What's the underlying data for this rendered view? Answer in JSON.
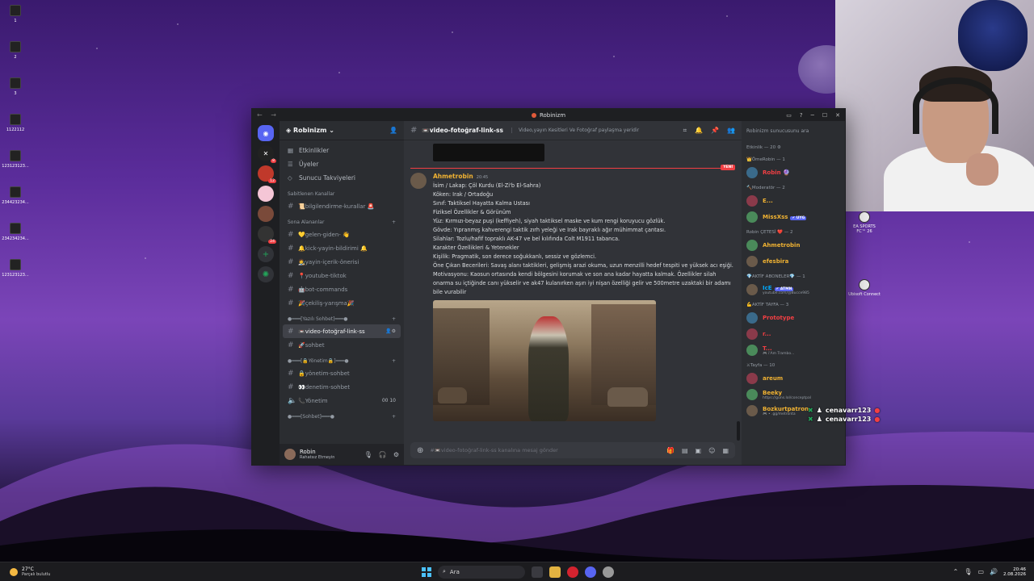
{
  "desktop": {
    "icons": [
      "1",
      "2",
      "3",
      "1122112",
      "123123123...",
      "234423234...",
      "234234234...",
      "123123123..."
    ],
    "right_icons": [
      {
        "label": "EA SPORTS FC™ 26"
      },
      {
        "label": "Ubisoft Connect"
      }
    ]
  },
  "window": {
    "title": "Robinizm",
    "nav": "← →"
  },
  "server": {
    "name": "Robinizm",
    "guild_badges": [
      "8",
      "12",
      "24"
    ],
    "top_items": [
      {
        "label": "Etkinlikler",
        "icon": "calendar-icon"
      },
      {
        "label": "Üyeler",
        "icon": "members-icon"
      },
      {
        "label": "Sunucu Takviyeleri",
        "icon": "boost-icon"
      }
    ],
    "pinned_category": "Sabitlenen Kanallar",
    "pinned_channels": [
      "📜bilgilendirme-kurallar 🚨"
    ],
    "recent_category": "Sona Alananlar",
    "recent_channels": [
      "💛gelen-giden- 👋",
      "🔔kick-yayin-bildirimi 🔔",
      "🧑‍🎨yayin-içerik-önerisi",
      "📍youtube-tiktok",
      "🤖bot-commands",
      "🎉çekiliş-yarışma🎉"
    ],
    "text_category": "●━━━[Yazılı Sohbet]━━━●",
    "text_channels": [
      {
        "label": "📼video-fotoğraf-link-ss",
        "active": true
      },
      {
        "label": "🚀sohbet",
        "active": false
      }
    ],
    "mgmt_category": "●━━━[🔒Yönetim🔒]━━━●",
    "mgmt_channels": [
      {
        "label": "🔒yönetim-sohbet",
        "tail": ""
      },
      {
        "label": "👀denetim-sohbet",
        "tail": ""
      },
      {
        "label": "📞Yönetim",
        "tail": "00  10"
      }
    ],
    "chat_category": "●━━━[Sohbet]━━━●"
  },
  "user": {
    "name": "Robin",
    "status": "Rahatsız Etmeyin"
  },
  "chat": {
    "channel": "📼video-fotoğraf-link-ss",
    "topic": "Video,yayın Kesitleri Ve Fotoğraf paylaşma yeridir",
    "new_label": "YENİ",
    "message": {
      "author": "Ahmetrobin",
      "time": "20:45",
      "lines": [
        "İsim / Lakap: Çöl Kurdu (El-Zi'b El-Sahra)",
        "Köken: Irak / Ortadoğu",
        "Sınıf: Taktiksel Hayatta Kalma Ustası",
        "Fiziksel Özellikler & Görünüm",
        "Yüz: Kırmızı-beyaz puşi (keffiyeh), siyah taktiksel maske ve kum rengi koruyucu gözlük.",
        "Gövde: Yıpranmış kahverengi taktik zırh yeleği ve Irak bayraklı ağır mühimmat çantası.",
        "Silahlar: Tozlu/hafif topraklı AK-47 ve bel kılıfında Colt M1911 tabanca.",
        "Karakter Özellikleri & Yetenekler",
        "Kişilik: Pragmatik, son derece soğukkanlı, sessiz ve gözlemci.",
        "Öne Çıkan Becerileri: Savaş alanı taktikleri, gelişmiş arazi okuma, uzun menzilli hedef tespiti ve yüksek acı eşiği.",
        "Motivasyonu: Kaosun ortasında kendi bölgesini korumak ve son ana kadar hayatta kalmak. Özellikler silah onarma su içtiğinde canı yükselir ve ak47 kulanırken aşırı iyi nişan özelliği gelir ve 500metre uzaktaki bir adamı bile vurabilir"
      ]
    },
    "composer_placeholder": "#📼video-fotoğraf-link-ss kanalına mesaj gönder"
  },
  "members": {
    "search_placeholder": "Robinizm sunucusunu ara",
    "groups": [
      {
        "title": "Etkinlik — 20 ⚙",
        "members": []
      },
      {
        "title": "👑ÖmeRobin — 1",
        "members": [
          {
            "name": "Robin 🔮",
            "sub": "",
            "tag": "",
            "color": "#f23f43"
          }
        ]
      },
      {
        "title": "🔨Moderatör — 2",
        "members": [
          {
            "name": "E...",
            "sub": "",
            "tag": "",
            "color": "#f0b232"
          },
          {
            "name": "MissXss",
            "sub": "",
            "tag": "✔ UYG",
            "color": "#f0b232"
          }
        ]
      },
      {
        "title": "Robin ÇETESİ ❤️ — 2",
        "members": [
          {
            "name": "Ahmetrobin",
            "sub": "",
            "tag": "",
            "color": "#f0b232"
          },
          {
            "name": "efesbira",
            "sub": "",
            "tag": "",
            "color": "#f0b232"
          }
        ]
      },
      {
        "title": "💎AKTİF ABONELER💎 — 1",
        "members": [
          {
            "name": "IcE",
            "sub": "youtube.com/@Bucce985",
            "tag": "✔ ATMN",
            "color": "#00a8fc"
          }
        ]
      },
      {
        "title": "💪AKTİF TAYFA — 3",
        "members": [
          {
            "name": "Prototype",
            "sub": "",
            "tag": "",
            "color": "#f23f43"
          },
          {
            "name": "r...",
            "sub": "",
            "tag": "",
            "color": "#f23f43"
          },
          {
            "name": "T...",
            "sub": "🎮 i'Am Trambo...",
            "tag": "",
            "color": "#f23f43"
          }
        ]
      },
      {
        "title": "⚔Tayfa — 10",
        "members": [
          {
            "name": "areum",
            "sub": "",
            "tag": "",
            "color": "#f0b232"
          },
          {
            "name": "Beeky",
            "sub": "https://guns.lol/conceptpal",
            "tag": "",
            "color": "#f0b232"
          },
          {
            "name": "Bozkurtpatron",
            "sub": "🎮 • .gg/metronta",
            "tag": "",
            "color": "#f0b232"
          }
        ]
      }
    ]
  },
  "overlay": {
    "names": [
      "cenavarr123",
      "cenavarr123"
    ]
  },
  "taskbar": {
    "temp": "27°C",
    "weather": "Parçalı bulutlu",
    "search": "Ara",
    "time": "20:46",
    "date": "2.08.2026"
  },
  "colors": {
    "accent": "#5865f2",
    "danger": "#f23f43",
    "online": "#23a55a",
    "author": "#f0b232"
  }
}
